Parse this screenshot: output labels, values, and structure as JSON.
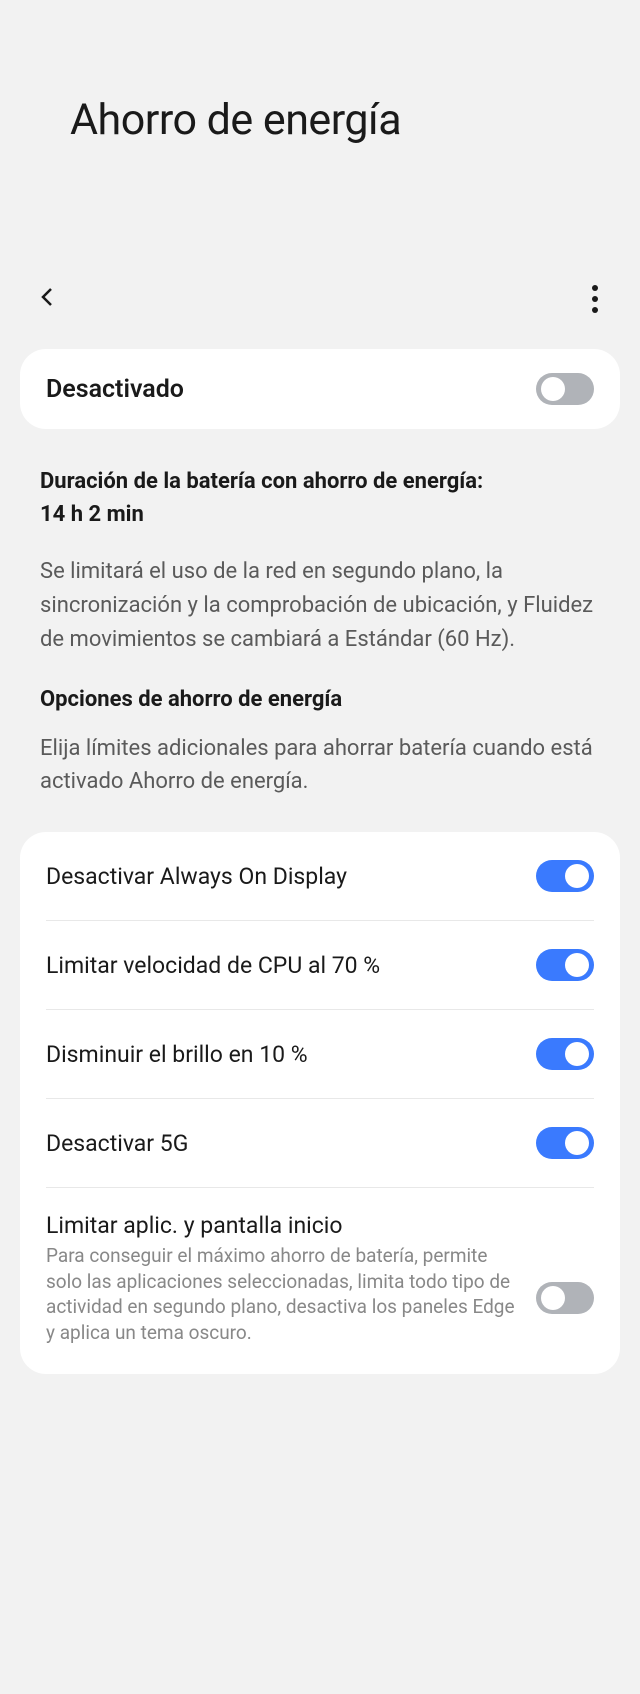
{
  "page": {
    "title": "Ahorro de energía"
  },
  "master": {
    "label": "Desactivado",
    "enabled": false
  },
  "info": {
    "duration_label": "Duración de la batería con ahorro de energía:",
    "duration_value": "14 h 2 min",
    "description": "Se limitará el uso de la red en segundo plano, la sincronización y la comprobación de ubicación, y Fluidez de movimientos se cambiará a Estándar (60 Hz).",
    "options_title": "Opciones de ahorro de energía",
    "options_desc": "Elija límites adicionales para ahorrar batería cuando está activado Ahorro de energía."
  },
  "options": [
    {
      "label": "Desactivar Always On Display",
      "enabled": true
    },
    {
      "label": "Limitar velocidad de CPU al 70 %",
      "enabled": true
    },
    {
      "label": "Disminuir el brillo en 10 %",
      "enabled": true
    },
    {
      "label": "Desactivar 5G",
      "enabled": true
    }
  ],
  "limit_apps": {
    "label": "Limitar aplic. y pantalla inicio",
    "description": "Para conseguir el máximo ahorro de batería, permite solo las aplicaciones seleccionadas, limita todo tipo de actividad en segundo plano, desactiva los paneles Edge y aplica un tema oscuro.",
    "enabled": false
  }
}
